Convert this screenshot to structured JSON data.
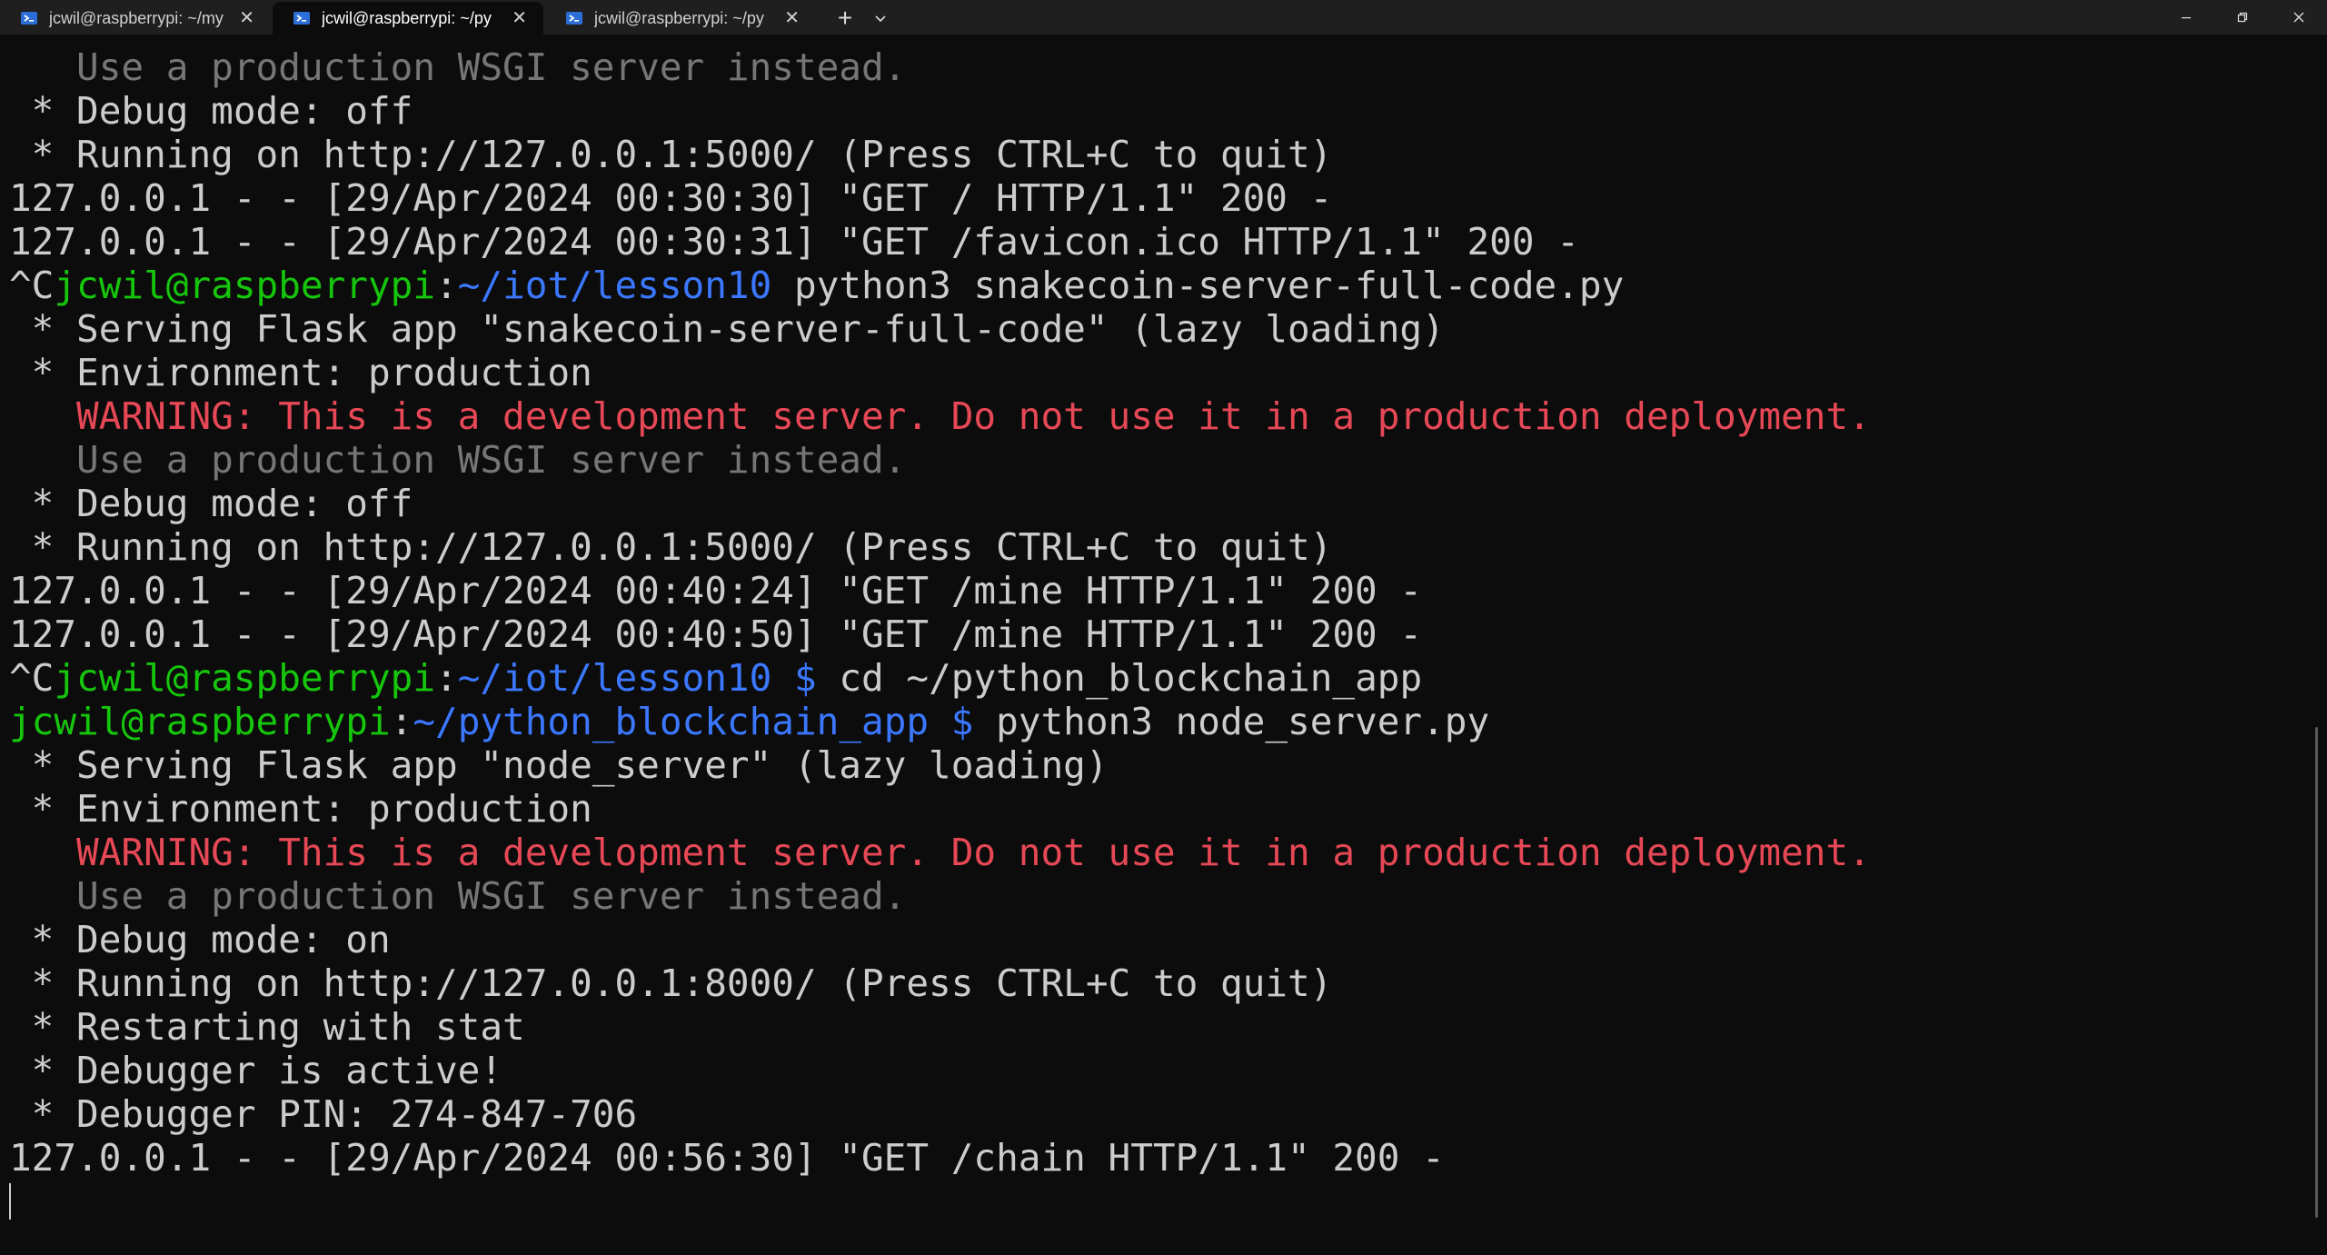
{
  "tabs": [
    {
      "title": "jcwil@raspberrypi: ~/my",
      "close": "✕",
      "active": false
    },
    {
      "title": "jcwil@raspberrypi: ~/py",
      "close": "✕",
      "active": true
    },
    {
      "title": "jcwil@raspberrypi: ~/py",
      "close": "✕",
      "active": false
    }
  ],
  "tabbar": {
    "new_tab": "+",
    "dropdown": "⌄"
  },
  "window_controls": {
    "minimize": "minimize-icon",
    "maximize": "restore-icon",
    "close": "close-icon"
  },
  "colors": {
    "background": "#0c0c0c",
    "text": "#cccccc",
    "dim": "#767676",
    "warning": "#e74856",
    "prompt_user": "#16c60c",
    "prompt_path": "#3b78ff",
    "tabbar": "#1f1f1f"
  },
  "terminal": {
    "lines": [
      [
        {
          "c": "dim",
          "t": "   Use a production WSGI server instead."
        }
      ],
      [
        {
          "c": "w",
          "t": " * Debug mode: off"
        }
      ],
      [
        {
          "c": "w",
          "t": " * Running on http://127.0.0.1:5000/ (Press CTRL+C to quit)"
        }
      ],
      [
        {
          "c": "w",
          "t": "127.0.0.1 - - [29/Apr/2024 00:30:30] \"GET / HTTP/1.1\" 200 -"
        }
      ],
      [
        {
          "c": "w",
          "t": "127.0.0.1 - - [29/Apr/2024 00:30:31] \"GET /favicon.ico HTTP/1.1\" 200 -"
        }
      ],
      [
        {
          "c": "w",
          "t": "^C"
        },
        {
          "c": "green",
          "t": "jcwil@raspberrypi"
        },
        {
          "c": "w",
          "t": ":"
        },
        {
          "c": "blue",
          "t": "~/iot/lesson10"
        },
        {
          "c": "w",
          "t": " python3 snakecoin-server-full-code.py"
        }
      ],
      [
        {
          "c": "w",
          "t": " * Serving Flask app \"snakecoin-server-full-code\" (lazy loading)"
        }
      ],
      [
        {
          "c": "w",
          "t": " * Environment: production"
        }
      ],
      [
        {
          "c": "red",
          "t": "   WARNING: This is a development server. Do not use it in a production deployment."
        }
      ],
      [
        {
          "c": "dim",
          "t": "   Use a production WSGI server instead."
        }
      ],
      [
        {
          "c": "w",
          "t": " * Debug mode: off"
        }
      ],
      [
        {
          "c": "w",
          "t": " * Running on http://127.0.0.1:5000/ (Press CTRL+C to quit)"
        }
      ],
      [
        {
          "c": "w",
          "t": "127.0.0.1 - - [29/Apr/2024 00:40:24] \"GET /mine HTTP/1.1\" 200 -"
        }
      ],
      [
        {
          "c": "w",
          "t": "127.0.0.1 - - [29/Apr/2024 00:40:50] \"GET /mine HTTP/1.1\" 200 -"
        }
      ],
      [
        {
          "c": "w",
          "t": "^C"
        },
        {
          "c": "green",
          "t": "jcwil@raspberrypi"
        },
        {
          "c": "w",
          "t": ":"
        },
        {
          "c": "blue",
          "t": "~/iot/lesson10 $"
        },
        {
          "c": "w",
          "t": " cd ~/python_blockchain_app"
        }
      ],
      [
        {
          "c": "green",
          "t": "jcwil@raspberrypi"
        },
        {
          "c": "w",
          "t": ":"
        },
        {
          "c": "blue",
          "t": "~/python_blockchain_app $"
        },
        {
          "c": "w",
          "t": " python3 node_server.py"
        }
      ],
      [
        {
          "c": "w",
          "t": " * Serving Flask app \"node_server\" (lazy loading)"
        }
      ],
      [
        {
          "c": "w",
          "t": " * Environment: production"
        }
      ],
      [
        {
          "c": "red",
          "t": "   WARNING: This is a development server. Do not use it in a production deployment."
        }
      ],
      [
        {
          "c": "dim",
          "t": "   Use a production WSGI server instead."
        }
      ],
      [
        {
          "c": "w",
          "t": " * Debug mode: on"
        }
      ],
      [
        {
          "c": "w",
          "t": " * Running on http://127.0.0.1:8000/ (Press CTRL+C to quit)"
        }
      ],
      [
        {
          "c": "w",
          "t": " * Restarting with stat"
        }
      ],
      [
        {
          "c": "w",
          "t": " * Debugger is active!"
        }
      ],
      [
        {
          "c": "w",
          "t": " * Debugger PIN: 274-847-706"
        }
      ],
      [
        {
          "c": "w",
          "t": "127.0.0.1 - - [29/Apr/2024 00:56:30] \"GET /chain HTTP/1.1\" 200 -"
        }
      ]
    ]
  }
}
